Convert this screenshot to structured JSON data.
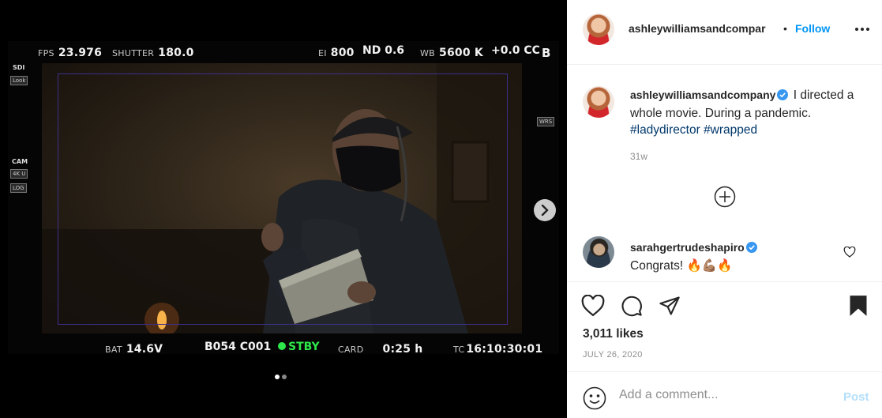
{
  "camera_hud": {
    "fps_label": "FPS",
    "fps_value": "23.976",
    "shutter_label": "SHUTTER",
    "shutter_value": "180.0",
    "ei_label": "EI",
    "ei_value": "800",
    "nd_value": "ND 0.6",
    "wb_label": "WB",
    "wb_value": "5600 K",
    "cc_value": "+0.0 CC",
    "corner_letter": "B",
    "sdi_label": "SDI",
    "look_tag": "Look",
    "cam_label": "CAM",
    "res_tag": "4K U",
    "log_tag": "LOG",
    "wrs_tag": "WRS",
    "bat_label": "BAT",
    "bat_value": "14.6V",
    "clip_value": "B054 C001",
    "stby_value": "STBY",
    "card_label": "CARD",
    "card_value": "0:25 h",
    "tc_label": "TC",
    "tc_value": "16:10:30:01",
    "stby_color": "#2ee84a"
  },
  "carousel": {
    "total_slides": 2,
    "active_slide": 1
  },
  "post": {
    "header_username": "ashleywilliamsandcompar",
    "separator": "•",
    "follow_label": "Follow",
    "caption_username": "ashleywilliamsandcompany",
    "caption_text": " I directed a whole movie. During a pandemic. ",
    "hashtag_1": "#ladydirector",
    "hashtag_2": "#wrapped",
    "caption_time": "31w",
    "comment_username": "sarahgertrudeshapiro",
    "comment_text": "Congrats! 🔥💪🏽🔥",
    "likes": "3,011 likes",
    "date": "JULY 26, 2020",
    "comment_placeholder": "Add a comment...",
    "post_label": "Post"
  },
  "colors": {
    "link_blue": "#0095f6",
    "hashtag": "#00376b",
    "muted": "#8e8e8e",
    "verified": "#3897f0"
  }
}
